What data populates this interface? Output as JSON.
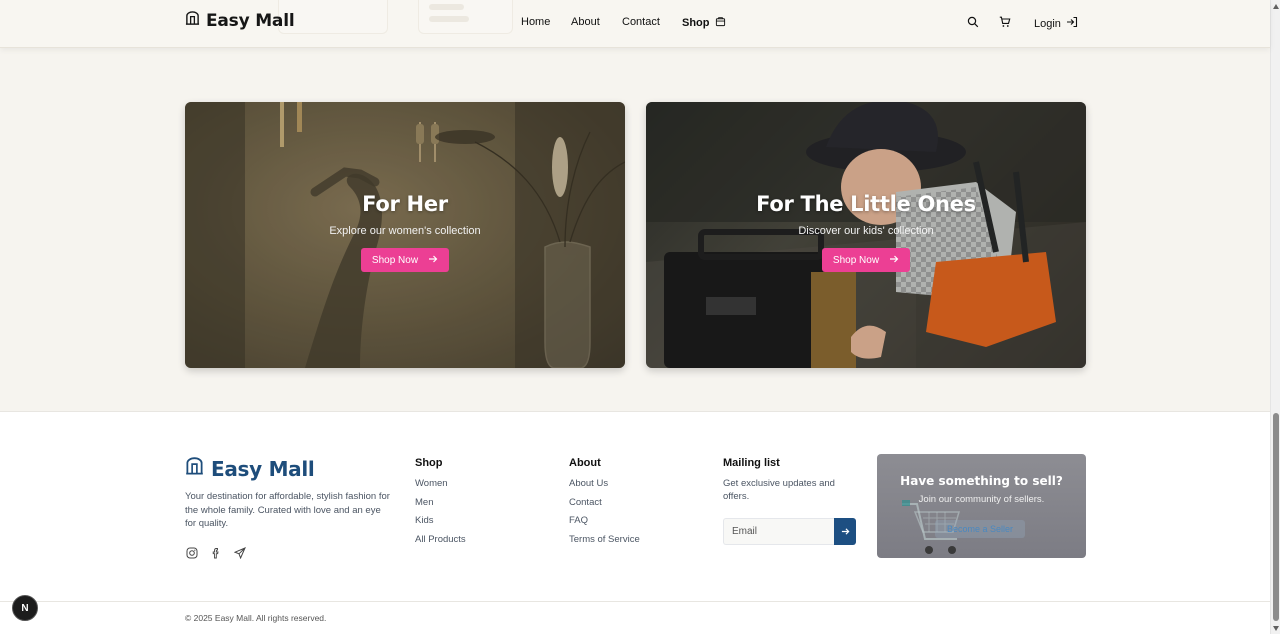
{
  "header": {
    "brand": "Easy Mall",
    "nav": [
      {
        "label": "Home"
      },
      {
        "label": "About"
      },
      {
        "label": "Contact"
      },
      {
        "label": "Shop"
      }
    ],
    "login_label": "Login",
    "icons": [
      "store-icon",
      "search-icon",
      "cart-icon",
      "login-arrow-icon",
      "shop-bag-icon"
    ]
  },
  "cards": [
    {
      "title": "For Her",
      "subtitle": "Explore our women's collection",
      "button": "Shop Now"
    },
    {
      "title": "For The Little Ones",
      "subtitle": "Discover our kids' collection",
      "button": "Shop Now"
    }
  ],
  "footer": {
    "brand": "Easy Mall",
    "description": "Your destination for affordable, stylish fashion for the whole family. Curated with love and an eye for quality.",
    "socials": [
      "instagram-icon",
      "facebook-icon",
      "send-icon"
    ],
    "shop": {
      "title": "Shop",
      "links": [
        "Women",
        "Men",
        "Kids",
        "All Products"
      ]
    },
    "about": {
      "title": "About",
      "links": [
        "About Us",
        "Contact",
        "FAQ",
        "Terms of Service"
      ]
    },
    "mailing": {
      "title": "Mailing list",
      "description": "Get exclusive updates and offers.",
      "email_placeholder": "Email"
    },
    "sell": {
      "title": "Have something to sell?",
      "subtitle": "Join our community of sellers.",
      "button": "Become a Seller"
    },
    "copyright": "© 2025 Easy Mall. All rights reserved."
  },
  "next_badge": "N",
  "colors": {
    "accent_pink": "#ec3f94",
    "brand_blue": "#1e4d7b",
    "page_bg": "#f6f4ef"
  }
}
